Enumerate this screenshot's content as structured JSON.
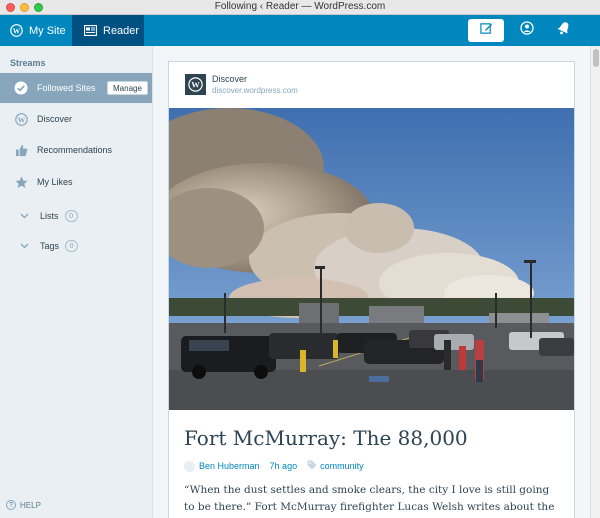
{
  "window": {
    "title": "Following ‹ Reader — WordPress.com"
  },
  "masterbar": {
    "my_site_label": "My Site",
    "reader_label": "Reader",
    "icons": {
      "my_site": "wordpress-logo-icon",
      "reader": "reader-icon",
      "write": "write-post-icon",
      "me": "user-circle-icon",
      "notifications": "bell-icon"
    }
  },
  "sidebar": {
    "streams_label": "Streams",
    "items": [
      {
        "label": "Followed Sites",
        "icon": "checkmark-circle-icon",
        "selected": true,
        "action_label": "Manage"
      },
      {
        "label": "Discover",
        "icon": "wordpress-logo-icon"
      },
      {
        "label": "Recommendations",
        "icon": "thumbs-up-icon"
      },
      {
        "label": "My Likes",
        "icon": "star-icon"
      }
    ],
    "lists": {
      "label": "Lists",
      "count": "0"
    },
    "tags": {
      "label": "Tags",
      "count": "0"
    },
    "help_label": "HELP"
  },
  "post": {
    "site_name": "Discover",
    "site_url": "discover.wordpress.com",
    "title": "Fort McMurray: The 88,000",
    "author": "Ben Huberman",
    "time_ago": "7h ago",
    "tag": "community",
    "excerpt": "“When the dust settles and smoke clears, the city I love is still going to be there.” Fort McMurray firefighter Lucas Welsh writes about the",
    "image_description_icon": "wildfire-smoke-photo"
  },
  "colors": {
    "masterbar": "#0087be",
    "masterbar_active": "#005082",
    "sidebar_selected": "#87a6bc",
    "link": "#0087be"
  }
}
